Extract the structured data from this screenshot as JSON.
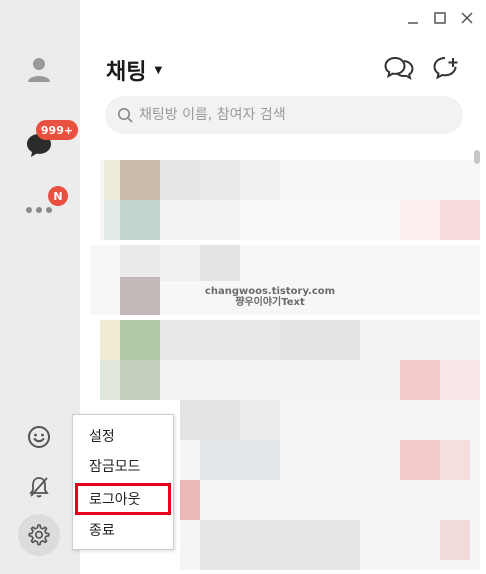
{
  "sidebar": {
    "chat_badge": "999+",
    "more_badge": "N",
    "icons": [
      "profile-icon",
      "chat-icon",
      "more-icon",
      "emoji-icon",
      "bell-off-icon",
      "gear-icon"
    ]
  },
  "window": {
    "minimize": "minimize",
    "maximize": "maximize",
    "close": "close"
  },
  "header": {
    "title": "채팅"
  },
  "search": {
    "placeholder": "채팅방 이름, 참여자 검색"
  },
  "watermark": {
    "line1": "changwoos.tistory.com",
    "line2": "쨩우이야기Text"
  },
  "settings_menu": {
    "items": [
      {
        "label": "설정"
      },
      {
        "label": "잠금모드"
      },
      {
        "label": "로그아웃"
      },
      {
        "label": "종료"
      }
    ]
  },
  "colors": {
    "badge": "#e8503f",
    "highlight_border": "#e8001c",
    "sidebar_bg": "#ececed"
  }
}
